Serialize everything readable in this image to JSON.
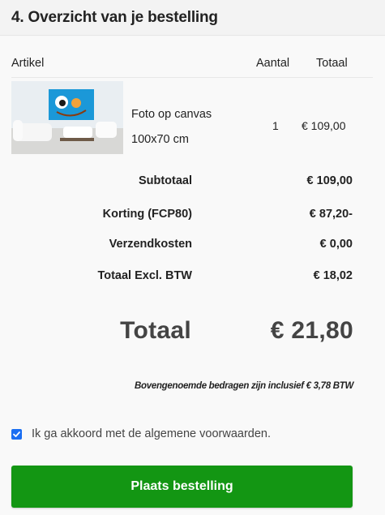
{
  "section": {
    "title": "4. Overzicht van je bestelling"
  },
  "table": {
    "headers": {
      "item": "Artikel",
      "qty": "Aantal",
      "total": "Totaal"
    },
    "rows": [
      {
        "name_line1": "Foto op canvas",
        "name_line2": "100x70 cm",
        "qty": "1",
        "price": "€ 109,00"
      }
    ]
  },
  "summary": {
    "subtotal_label": "Subtotaal",
    "subtotal_value": "€ 109,00",
    "discount_label": "Korting (FCP80)",
    "discount_value": "€ 87,20-",
    "shipping_label": "Verzendkosten",
    "shipping_value": "€ 0,00",
    "excl_label": "Totaal Excl. BTW",
    "excl_value": "€ 18,02",
    "total_label": "Totaal",
    "total_value": "€ 21,80",
    "vat_note": "Bovengenoemde bedragen zijn inclusief € 3,78 BTW"
  },
  "terms": {
    "checked": true,
    "label": "Ik ga akkoord met de algemene voorwaarden."
  },
  "actions": {
    "place_order": "Plaats bestelling"
  },
  "colors": {
    "button": "#139613",
    "checkbox": "#1a6ef2",
    "canvas_print": "#1b98d8"
  }
}
